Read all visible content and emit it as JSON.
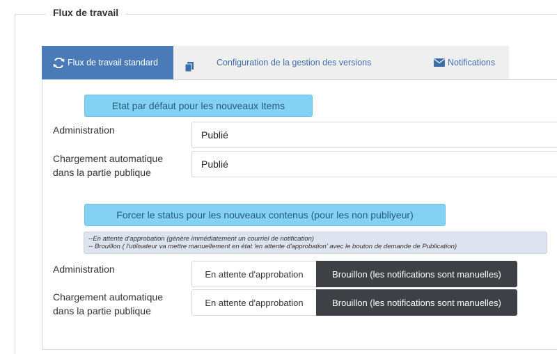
{
  "fieldset": {
    "legend": "Flux de travail"
  },
  "tabs": [
    {
      "label": "Flux de travail standard",
      "icon": "refresh-icon",
      "active": true
    },
    {
      "label": "Configuration de la gestion des versions",
      "icon": "copy-icon",
      "active": false
    },
    {
      "label": "Notifications",
      "icon": "envelope-icon",
      "active": false
    }
  ],
  "default_state": {
    "title": "Etat par défaut pour les nouveaux Items",
    "rows": [
      {
        "label": "Administration",
        "value": "Publié"
      },
      {
        "label": "Chargement automatique dans la partie publique",
        "value": "Publié"
      }
    ]
  },
  "force_status": {
    "title": "Forcer le status pour les nouveaux contenus (pour les non publiyeur)",
    "note_line1": "--En attente d'approbation (génère immédiatement un courriel de notification)",
    "note_line2": "-- Brouillon ( l'utilisateur va mettre manuellement en état 'en attente d'approbation' avec le bouton de demande de Publication)",
    "rows": [
      {
        "label": "Administration",
        "option_pending": "En attente d'approbation",
        "option_draft": "Brouillon (les notifications sont manuelles)",
        "selected": "draft"
      },
      {
        "label": "Chargement automatique dans la partie publique",
        "option_pending": "En attente d'approbation",
        "option_draft": "Brouillon (les notifications sont manuelles)",
        "selected": "draft"
      }
    ]
  },
  "colors": {
    "tab_active": "#4a7ab8",
    "banner": "#83d2f4",
    "btn_selected": "#3d4146",
    "note_bg": "#dde3ef"
  }
}
